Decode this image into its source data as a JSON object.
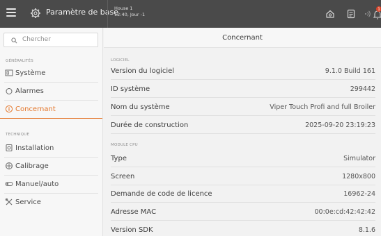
{
  "header": {
    "title": "Paramètre de base",
    "house_name": "House 1",
    "house_time": "12:40, Jour -1",
    "notification_count": "1"
  },
  "search": {
    "placeholder": "Chercher"
  },
  "sidebar": {
    "sections": [
      {
        "label": "GÉNÉRALITÉS",
        "items": [
          {
            "label": "Système",
            "icon": "system-icon"
          },
          {
            "label": "Alarmes",
            "icon": "alarm-icon"
          },
          {
            "label": "Concernant",
            "icon": "info-icon",
            "active": true
          }
        ]
      },
      {
        "label": "TECHNIQUE",
        "items": [
          {
            "label": "Installation",
            "icon": "installation-icon"
          },
          {
            "label": "Calibrage",
            "icon": "calibration-icon"
          },
          {
            "label": "Manuel/auto",
            "icon": "toggle-icon"
          },
          {
            "label": "Service",
            "icon": "wrench-icon"
          }
        ]
      }
    ]
  },
  "main": {
    "title": "Concernant",
    "groups": [
      {
        "label": "LOGICIEL",
        "rows": [
          {
            "key": "Version du logiciel",
            "value": "9.1.0 Build 161"
          },
          {
            "key": "ID système",
            "value": "299442"
          },
          {
            "key": "Nom du système",
            "value": "Viper Touch Profi and full Broiler"
          },
          {
            "key": "Durée de construction",
            "value": "2025-09-20 23:19:23"
          }
        ]
      },
      {
        "label": "MODULE CPU",
        "rows": [
          {
            "key": "Type",
            "value": "Simulator"
          },
          {
            "key": "Screen",
            "value": "1280x800"
          },
          {
            "key": "Demande de code de licence",
            "value": "16962-24"
          },
          {
            "key": "Adresse MAC",
            "value": "00:0e:cd:42:42:42"
          },
          {
            "key": "Version SDK",
            "value": "8.1.6"
          }
        ]
      }
    ]
  },
  "colors": {
    "accent": "#e4762a",
    "topbar": "#4a4a4a",
    "badge": "#d9462b"
  }
}
